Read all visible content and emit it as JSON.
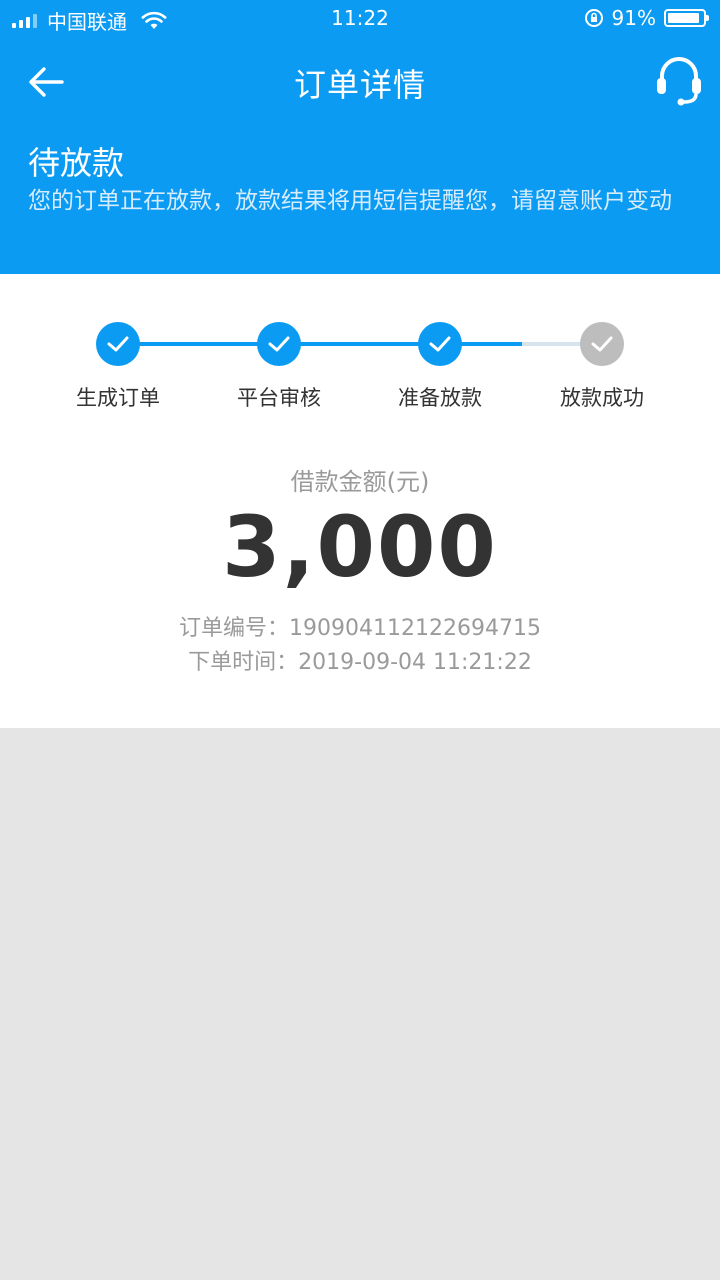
{
  "status_bar": {
    "carrier": "中国联通",
    "time": "11:22",
    "battery_percent": "91%",
    "battery_level": 0.91
  },
  "nav": {
    "title": "订单详情",
    "back_icon": "arrow-left-icon",
    "service_icon": "headset-icon"
  },
  "status": {
    "title": "待放款",
    "description": "您的订单正在放款，放款结果将用短信提醒您，请留意账户变动"
  },
  "steps": [
    {
      "label": "生成订单",
      "done": true
    },
    {
      "label": "平台审核",
      "done": true
    },
    {
      "label": "准备放款",
      "done": true
    },
    {
      "label": "放款成功",
      "done": false
    }
  ],
  "loan": {
    "amount_label": "借款金额(元)",
    "amount": "3,000"
  },
  "order": {
    "number_label": "订单编号：",
    "number": "190904112122694715",
    "time_label": "下单时间：",
    "time": "2019-09-04 11:21:22"
  },
  "colors": {
    "primary": "#0b9bf2",
    "background": "#e5e5e5",
    "pending": "#bdbdbd"
  }
}
